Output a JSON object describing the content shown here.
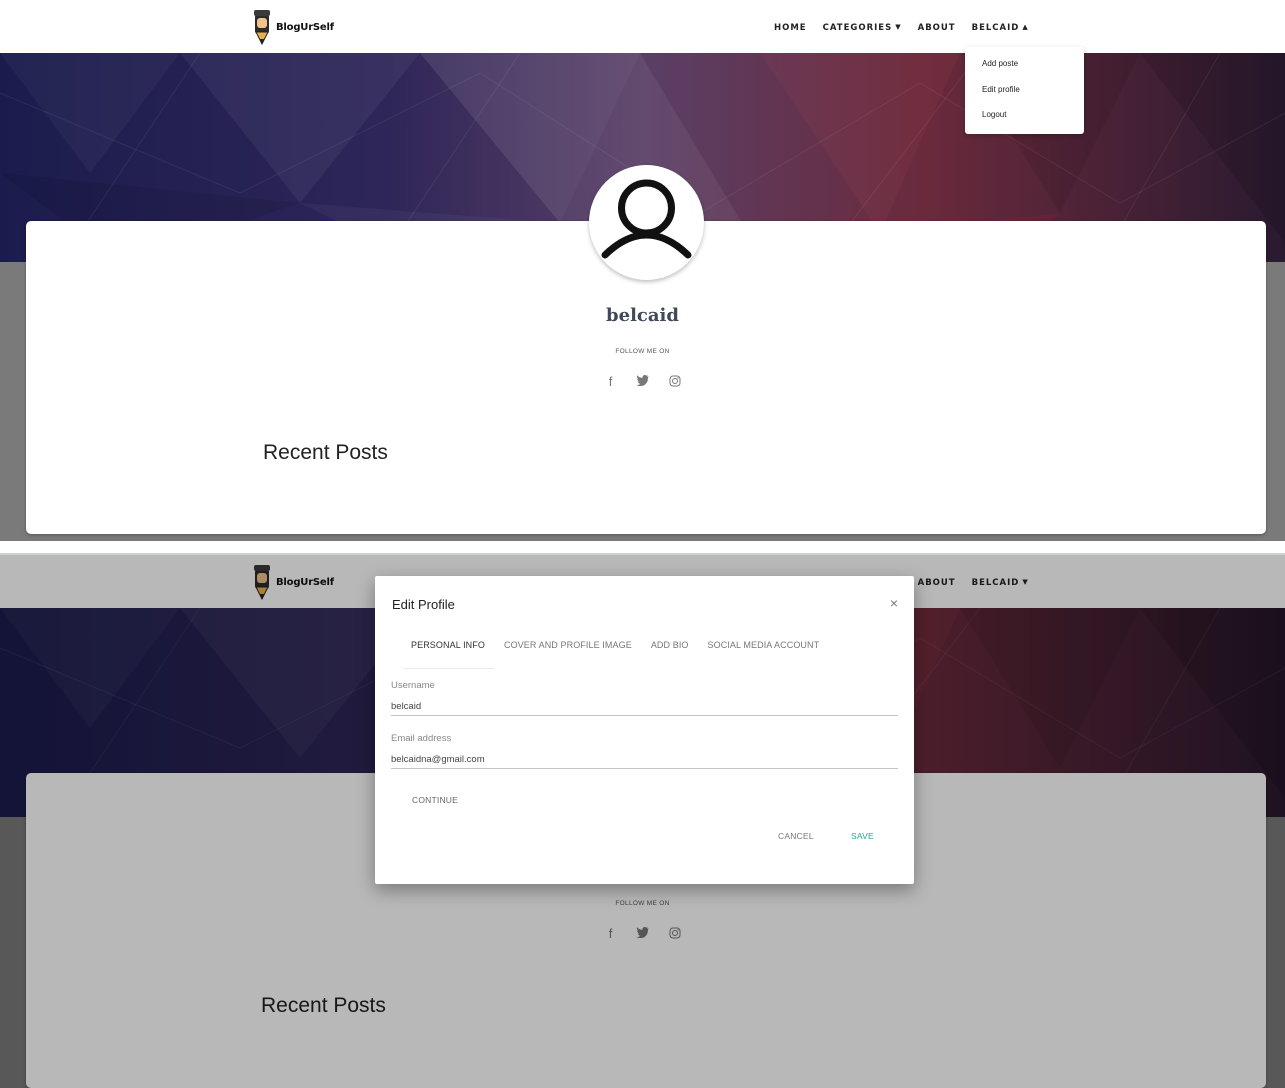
{
  "brand": {
    "name": "BlogUrSelf"
  },
  "nav": {
    "home": "HOME",
    "categories": "CATEGORIES",
    "about": "ABOUT",
    "user": "BELCAID"
  },
  "user_menu": {
    "items": [
      "Add poste",
      "Edit profile",
      "Logout"
    ]
  },
  "profile": {
    "username": "belcaid",
    "follow_label": "FOLLOW ME ON",
    "social_icons": [
      "facebook-icon",
      "twitter-icon",
      "instagram-icon"
    ]
  },
  "recent_posts": {
    "heading": "Recent Posts"
  },
  "modal": {
    "title": "Edit Profile",
    "close": "×",
    "tabs": [
      "PERSONAL INFO",
      "COVER AND PROFILE IMAGE",
      "ADD BIO",
      "SOCIAL MEDIA ACCOUNT"
    ],
    "active_tab": "PERSONAL INFO",
    "username_label": "Username",
    "username_value": "belcaid",
    "email_label": "Email address",
    "email_value": "belcaidna@gmail.com",
    "continue": "CONTINUE",
    "cancel": "CANCEL",
    "save": "SAVE"
  },
  "colors": {
    "accent_save": "#26a69a",
    "hero_dark": "#1c1c4a",
    "hero_red": "#6e2030"
  }
}
